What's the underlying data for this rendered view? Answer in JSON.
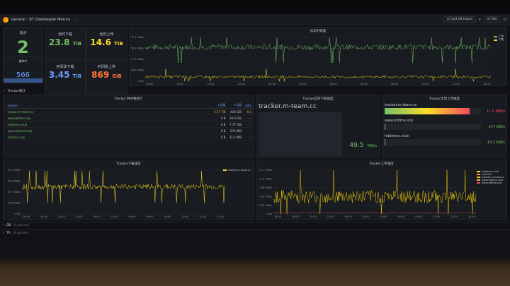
{
  "topbar": {
    "breadcrumb_root": "General",
    "breadcrumb_separator": "/",
    "dashboard_title": "BT Downloader Metrics",
    "time_range": "Last 24 hours",
    "refresh": "10s"
  },
  "stats": {
    "sites": {
      "label": "站点",
      "value": "2"
    },
    "total_download": {
      "label": "全时下载",
      "value": "23.8",
      "unit": "TiB"
    },
    "total_upload": {
      "label": "全时上传",
      "value": "14.6",
      "unit": "TiB"
    },
    "seeding": {
      "label": "做种中",
      "value": "566"
    },
    "period_download": {
      "label": "时间段下载",
      "value": "3.45",
      "unit": "TiB"
    },
    "period_upload": {
      "label": "时间段上传",
      "value": "869",
      "unit": "GiB"
    }
  },
  "upload_speed_panel": {
    "title": "总实时速度",
    "y_ticks": [
      "75.1 MiB/s",
      "56.3 MiB/s",
      "37.5 MiB/s",
      "18.8 MiB/s",
      "0 B/s"
    ],
    "x_ticks": [
      "16:00",
      "18:00",
      "20:00",
      "22:00",
      "00:00",
      "02:00",
      "04:00",
      "06:00",
      "08:00",
      "10:00",
      "12:00",
      "14:00"
    ],
    "legend": [
      {
        "label": "上传",
        "color": "#73bf69"
      },
      {
        "label": "下载",
        "color": "#fade2a"
      }
    ]
  },
  "tracker_row": {
    "title": "Tracker统计"
  },
  "tracker_table": {
    "title": "Tracker 种子数统计",
    "columns": [
      "tracker",
      "↓总量",
      "↑总量",
      "ratio"
    ],
    "rows": [
      {
        "site": "tracker.m-team.cc",
        "down": "3.57 TiB",
        "up": "443 GiB",
        "ratio": "0.1"
      },
      {
        "site": "www.pttime.org",
        "down": "0 B",
        "up": "39.9 GiB",
        "ratio": "—"
      },
      {
        "site": "hdatmos.club",
        "down": "0 B",
        "up": "7.77 GiB",
        "ratio": "—"
      },
      {
        "site": "www.hdarea.club",
        "down": "0 B",
        "up": "270 MiB",
        "ratio": "—"
      },
      {
        "site": "hdchina.org",
        "down": "0 B",
        "up": "32.3 MiB",
        "ratio": "—"
      }
    ]
  },
  "tracker_download_top": {
    "title": "Tracker实时下载速度",
    "site": "tracker.m-team.cc",
    "value": "49.5",
    "unit": "MiB/s"
  },
  "tracker_upload_top": {
    "title": "Tracker实时上传速度",
    "bars": [
      {
        "site": "tracker.m-team.cc",
        "value": "11.0 MiB/s",
        "fraction": 0.88,
        "color": "#f2495c"
      },
      {
        "site": "www.pttime.org",
        "value": "147 KiB/s",
        "fraction": 0.01,
        "color": "#73bf69"
      },
      {
        "site": "hdatmos.club",
        "value": "19.2 KiB/s",
        "fraction": 0.005,
        "color": "#73bf69"
      }
    ]
  },
  "tracker_dl_chart": {
    "title": "Tracker下载速度",
    "y_ticks": [
      "75.3 MiB/s",
      "56.3 MiB/s",
      "37.7 MiB/s",
      "18.8 MiB/s",
      "0 B/s"
    ],
    "x_ticks": [
      "16:00",
      "18:00",
      "20:00",
      "22:00",
      "00:00",
      "02:00",
      "04:00",
      "06:00",
      "08:00",
      "10:00",
      "12:00",
      "14:00"
    ],
    "legend": [
      {
        "label": "tracker.m-team.cc",
        "color": "#fade2a"
      }
    ]
  },
  "tracker_ul_chart": {
    "title": "Tracker上传速度",
    "y_ticks": [
      "13.1 MiB/s",
      "10.5 MiB/s",
      "7.86 MiB/s",
      "5.24 MiB/s",
      "2.62 MiB/s",
      "0 B/s"
    ],
    "x_ticks": [
      "16:00",
      "18:00",
      "20:00",
      "22:00",
      "00:00",
      "02:00",
      "04:00",
      "06:00",
      "08:00",
      "10:00",
      "12:00",
      "14:00"
    ],
    "legend": [
      {
        "label": "hdatmos.club",
        "color": "#fade2a"
      },
      {
        "label": "hdchina",
        "color": "#ff9830"
      },
      {
        "label": "tracker.m-team.cc",
        "color": "#f2cc0c"
      },
      {
        "label": "www.hdarea.club",
        "color": "#ffb357"
      },
      {
        "label": "www.pttime.org",
        "color": "#f2495c"
      }
    ]
  },
  "collapsed_rows": [
    {
      "title": "QB",
      "meta": "(4 panels)"
    },
    {
      "title": "TR",
      "meta": "(4 panels)"
    }
  ]
}
